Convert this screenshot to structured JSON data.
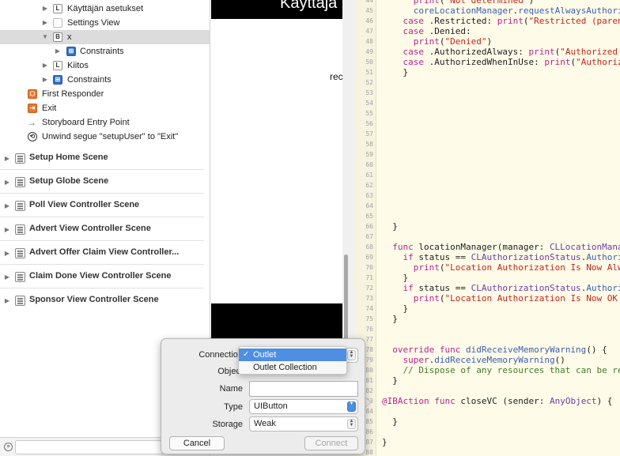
{
  "outline": {
    "rows": [
      {
        "label": "Käyttäjän asetukset",
        "icon": "L"
      },
      {
        "label": "Settings View",
        "icon": ""
      },
      {
        "label": "x",
        "icon": "B"
      },
      {
        "label": "Constraints",
        "icon": "⊞"
      },
      {
        "label": "Kiitos",
        "icon": "L"
      },
      {
        "label": "Constraints",
        "icon": "⊞"
      },
      {
        "label": "First Responder",
        "icon": "⬡"
      },
      {
        "label": "Exit",
        "icon": "⇥"
      },
      {
        "label": "Storyboard Entry Point",
        "icon": "→"
      },
      {
        "label": "Unwind segue \"setupUser\" to \"Exit\"",
        "icon": "⟲"
      }
    ],
    "scenes": [
      "Setup Home Scene",
      "Setup Globe Scene",
      "Poll View Controller Scene",
      "Advert View Controller Scene",
      "Advert Offer Claim View Controller...",
      "Claim Done View Controller Scene",
      "Sponsor View Controller Scene"
    ]
  },
  "canvas": {
    "title": "Käyttäjä",
    "label": "rec"
  },
  "editor": {
    "lines": [
      {
        "n": "44",
        "t": "      print(\"Not determined\")"
      },
      {
        "n": "45",
        "t": "      coreLocationManager.requestAlwaysAuthori"
      },
      {
        "n": "46",
        "t": "    case .Restricted: print(\"Restricted (paren"
      },
      {
        "n": "47",
        "t": "    case .Denied:"
      },
      {
        "n": "48",
        "t": "      print(\"Denied\")"
      },
      {
        "n": "49",
        "t": "    case .AuthorizedAlways: print(\"Authorized"
      },
      {
        "n": "50",
        "t": "    case .AuthorizedWhenInUse: print(\"Authoriz"
      },
      {
        "n": "51",
        "t": "    }"
      },
      {
        "n": "52",
        "t": ""
      },
      {
        "n": "53",
        "t": ""
      },
      {
        "n": "54",
        "t": ""
      },
      {
        "n": "55",
        "t": ""
      },
      {
        "n": "56",
        "t": ""
      },
      {
        "n": "57",
        "t": ""
      },
      {
        "n": "58",
        "t": ""
      },
      {
        "n": "59",
        "t": ""
      },
      {
        "n": "60",
        "t": ""
      },
      {
        "n": "61",
        "t": ""
      },
      {
        "n": "62",
        "t": ""
      },
      {
        "n": "63",
        "t": ""
      },
      {
        "n": "64",
        "t": ""
      },
      {
        "n": "65",
        "t": ""
      },
      {
        "n": "66",
        "t": "  }"
      },
      {
        "n": "67",
        "t": ""
      },
      {
        "n": "68",
        "t": "  func locationManager(manager: CLLocationMana"
      },
      {
        "n": "69",
        "t": "    if status == CLAuthorizationStatus.Authori"
      },
      {
        "n": "70",
        "t": "      print(\"Location Authorization Is Now Alw"
      },
      {
        "n": "71",
        "t": "    }"
      },
      {
        "n": "72",
        "t": "    if status == CLAuthorizationStatus.Authori"
      },
      {
        "n": "73",
        "t": "      print(\"Location Authorization Is Now OK"
      },
      {
        "n": "74",
        "t": "    }"
      },
      {
        "n": "75",
        "t": "  }"
      },
      {
        "n": "76",
        "t": ""
      },
      {
        "n": "77",
        "t": ""
      },
      {
        "n": "78",
        "t": "  override func didReceiveMemoryWarning() {"
      },
      {
        "n": "79",
        "t": "    super.didReceiveMemoryWarning()"
      },
      {
        "n": "80",
        "t": "    // Dispose of any resources that can be re"
      },
      {
        "n": "81",
        "t": "  }"
      },
      {
        "n": "82",
        "t": ""
      },
      {
        "n": "83",
        "t": "@IBAction func closeVC (sender: AnyObject) {"
      },
      {
        "n": "84",
        "t": ""
      },
      {
        "n": "85",
        "t": "  }"
      },
      {
        "n": "86",
        "t": ""
      },
      {
        "n": "87",
        "t": "}"
      },
      {
        "n": "88",
        "t": ""
      }
    ]
  },
  "popover": {
    "connection_label": "Connection",
    "object_label": "Object",
    "name_label": "Name",
    "name_value": "",
    "type_label": "Type",
    "type_value": "UIButton",
    "storage_label": "Storage",
    "storage_value": "Weak",
    "cancel_label": "Cancel",
    "connect_label": "Connect",
    "menu": [
      {
        "label": "Outlet",
        "checked": true
      },
      {
        "label": "Outlet Collection",
        "checked": false
      }
    ]
  },
  "colors": {
    "keyword": "#b7268e",
    "string": "#c4261d",
    "type": "#6c3ea4",
    "comment": "#3f7d2b",
    "menu_highlight": "#4e8ee3",
    "editor_bg": "#fefbe8"
  }
}
